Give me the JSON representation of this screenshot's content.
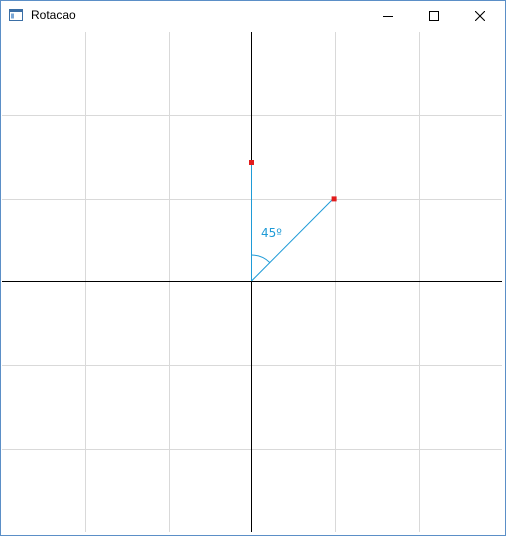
{
  "window": {
    "title": "Rotacao",
    "buttons": {
      "minimize": "minimize-icon",
      "maximize": "maximize-icon",
      "close": "close-icon"
    }
  },
  "canvas": {
    "background": "#ffffff",
    "grid_color": "#d9d9d9",
    "axis_color": "#000000",
    "grid_cells": 6,
    "vector_color": "#1f9bd7",
    "point_color": "#e21c1c",
    "angle_label": "45º",
    "rotation_degrees": 45
  }
}
